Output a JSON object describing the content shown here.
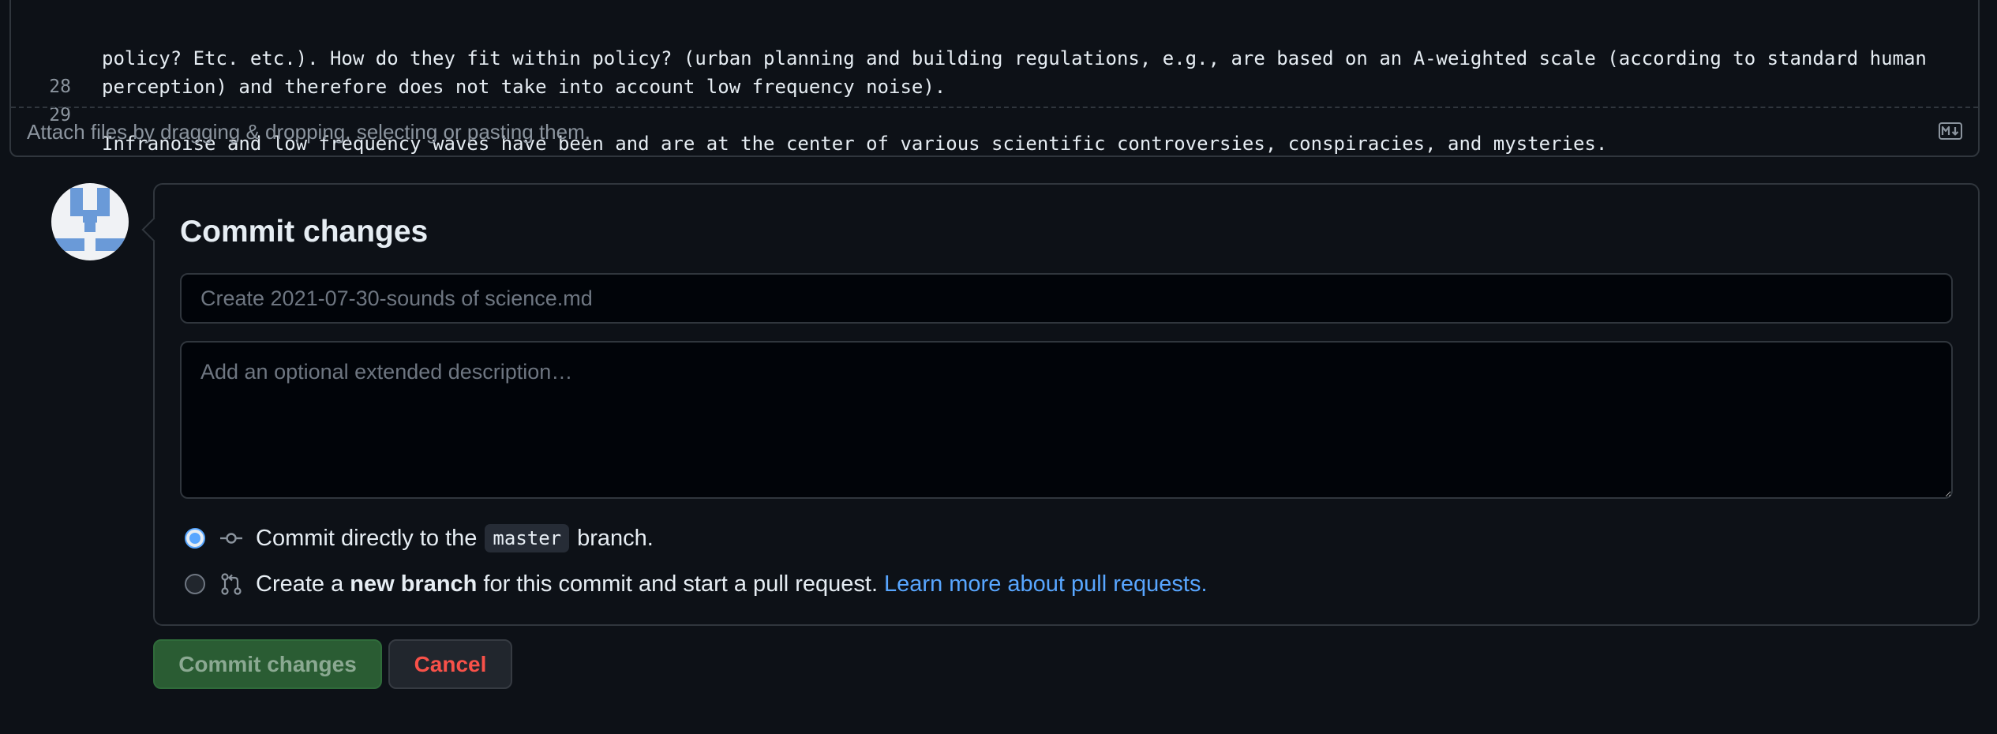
{
  "editor": {
    "lines": [
      {
        "number": "",
        "text": "policy? Etc. etc.). How do they fit within policy? (urban planning and building regulations, e.g., are based on an A-weighted scale (according to standard human"
      },
      {
        "number": "",
        "text": "perception) and therefore does not take into account low frequency noise)."
      },
      {
        "number": "28",
        "text": ""
      },
      {
        "number": "29",
        "text": "Infranoise and low frequency waves have been and are at the center of various scientific controversies, conspiracies, and mysteries."
      }
    ],
    "attach_hint": "Attach files by dragging & dropping, selecting or pasting them.",
    "markdown_icon": "markdown-icon"
  },
  "commit": {
    "title": "Commit changes",
    "summary_placeholder": "Create 2021-07-30-sounds of science.md",
    "description_placeholder": "Add an optional extended description…",
    "option_direct": {
      "prefix": "Commit directly to the",
      "branch": "master",
      "suffix": "branch.",
      "icon": "git-commit-icon",
      "selected": true
    },
    "option_new_branch": {
      "prefix": "Create a",
      "bold": "new branch",
      "suffix": "for this commit and start a pull request.",
      "link": "Learn more about pull requests.",
      "icon": "git-pull-request-icon",
      "selected": false
    }
  },
  "buttons": {
    "commit_label": "Commit changes",
    "cancel_label": "Cancel"
  },
  "colors": {
    "background": "#0d1117",
    "border": "#30363d",
    "link": "#58a6ff",
    "danger": "#f85149",
    "commit_button": "#2a5c33"
  }
}
